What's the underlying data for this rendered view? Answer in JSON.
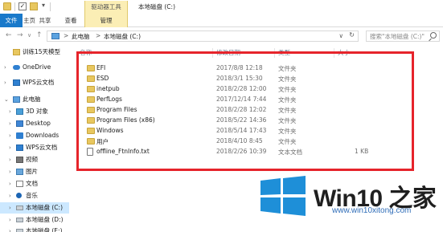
{
  "window": {
    "title": "本地磁盘 (C:)",
    "drive_tools_label": "驱动器工具"
  },
  "quick_access": {
    "icons": [
      "folder-icon",
      "checkbox-icon",
      "folder-icon",
      "dropdown-icon"
    ]
  },
  "ribbon": {
    "tabs": [
      {
        "label": "文件",
        "active": true
      },
      {
        "label": "主页"
      },
      {
        "label": "共享"
      },
      {
        "label": "查看"
      },
      {
        "label": "管理"
      }
    ]
  },
  "address": {
    "sep0": ">",
    "crumbs": [
      "此电脑",
      "本地磁盘 (C:)"
    ],
    "sep": ">",
    "dropdown": "∨",
    "refresh": "↻",
    "search_placeholder": "搜索\"本地磁盘 (C:)\""
  },
  "sidebar": {
    "items": [
      {
        "label": "训练15天模型",
        "icon": "folder-icon"
      },
      {
        "label": "OneDrive",
        "icon": "cloud-icon"
      },
      {
        "label": "WPS云文档",
        "icon": "wps-icon"
      },
      {
        "label": "此电脑",
        "icon": "pc-icon"
      },
      {
        "label": "3D 对象",
        "icon": "3d-objects-icon"
      },
      {
        "label": "Desktop",
        "icon": "desktop-icon"
      },
      {
        "label": "Downloads",
        "icon": "download-icon"
      },
      {
        "label": "WPS云文档",
        "icon": "wps-icon"
      },
      {
        "label": "视频",
        "icon": "video-icon"
      },
      {
        "label": "图片",
        "icon": "picture-icon"
      },
      {
        "label": "文档",
        "icon": "document-icon"
      },
      {
        "label": "音乐",
        "icon": "music-icon"
      },
      {
        "label": "本地磁盘 (C:)",
        "icon": "drive-icon",
        "selected": true
      },
      {
        "label": "本地磁盘 (D:)",
        "icon": "drive-icon"
      },
      {
        "label": "本地磁盘 (E:)",
        "icon": "drive-icon"
      }
    ]
  },
  "columns": {
    "name": "名称",
    "date": "修改日期",
    "type": "类型",
    "size": "大小"
  },
  "files": [
    {
      "name": "EFI",
      "date": "2017/8/8 12:18",
      "type": "文件夹",
      "size": "",
      "kind": "folder"
    },
    {
      "name": "ESD",
      "date": "2018/3/1 15:30",
      "type": "文件夹",
      "size": "",
      "kind": "folder"
    },
    {
      "name": "inetpub",
      "date": "2018/2/28 12:00",
      "type": "文件夹",
      "size": "",
      "kind": "folder"
    },
    {
      "name": "PerfLogs",
      "date": "2017/12/14 7:44",
      "type": "文件夹",
      "size": "",
      "kind": "folder"
    },
    {
      "name": "Program Files",
      "date": "2018/2/28 12:02",
      "type": "文件夹",
      "size": "",
      "kind": "folder"
    },
    {
      "name": "Program Files (x86)",
      "date": "2018/5/22 14:36",
      "type": "文件夹",
      "size": "",
      "kind": "folder"
    },
    {
      "name": "Windows",
      "date": "2018/5/14 17:43",
      "type": "文件夹",
      "size": "",
      "kind": "folder"
    },
    {
      "name": "用户",
      "date": "2018/4/10 8:45",
      "type": "文件夹",
      "size": "",
      "kind": "folder"
    },
    {
      "name": "offline_FtnInfo.txt",
      "date": "2018/2/26 10:39",
      "type": "文本文档",
      "size": "1 KB",
      "kind": "text"
    }
  ],
  "watermark": {
    "brand": "Win10 之家",
    "url": "www.win10xitong.com"
  },
  "colors": {
    "file_tab": "#1979ca",
    "highlight": "#e6242b",
    "selected": "#cce8ff",
    "folder": "#e8c75f",
    "win_logo": "#1e8fd8"
  }
}
